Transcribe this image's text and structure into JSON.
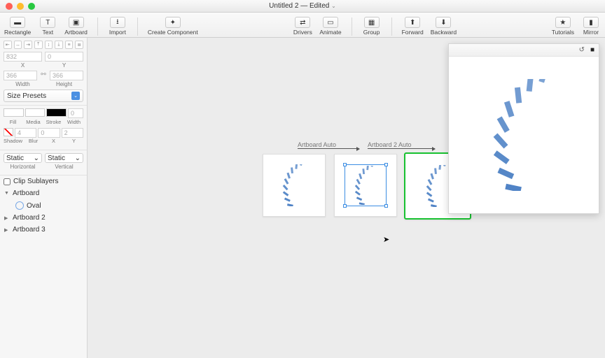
{
  "window": {
    "title": "Untitled 2 — Edited"
  },
  "toolbar": {
    "rectangle": "Rectangle",
    "text": "Text",
    "artboard": "Artboard",
    "import": "Import",
    "create_component": "Create Component",
    "drivers": "Drivers",
    "animate": "Animate",
    "group": "Group",
    "forward": "Forward",
    "backward": "Backward",
    "tutorials": "Tutorials",
    "mirror": "Mirror"
  },
  "inspector": {
    "x_val": "832",
    "y_val": "0",
    "x_lbl": "X",
    "y_lbl": "Y",
    "w_val": "366",
    "h_val": "366",
    "w_lbl": "Width",
    "h_lbl": "Height",
    "size_presets": "Size Presets",
    "fill_lbl": "Fill",
    "media_lbl": "Media",
    "stroke_lbl": "Stroke",
    "swidth_lbl": "Width",
    "swidth_val": "0",
    "shadow_lbl": "Shadow",
    "blur_lbl": "Blur",
    "sx_lbl": "X",
    "sy_lbl": "Y",
    "blur_val": "4",
    "sx_val": "0",
    "sy_val": "2",
    "static": "Static",
    "horizontal": "Horizontal",
    "vertical": "Vertical",
    "clip": "Clip Sublayers"
  },
  "layers": {
    "items": [
      {
        "name": "Artboard",
        "expanded": true
      },
      {
        "name": "Oval",
        "child": true
      },
      {
        "name": "Artboard 2",
        "expanded": false
      },
      {
        "name": "Artboard 3",
        "expanded": false
      }
    ]
  },
  "canvas": {
    "label1": "Artboard Auto",
    "label2": "Artboard 2 Auto"
  },
  "spinner": {
    "segments": 30,
    "base_color": "#4a7fc4"
  }
}
